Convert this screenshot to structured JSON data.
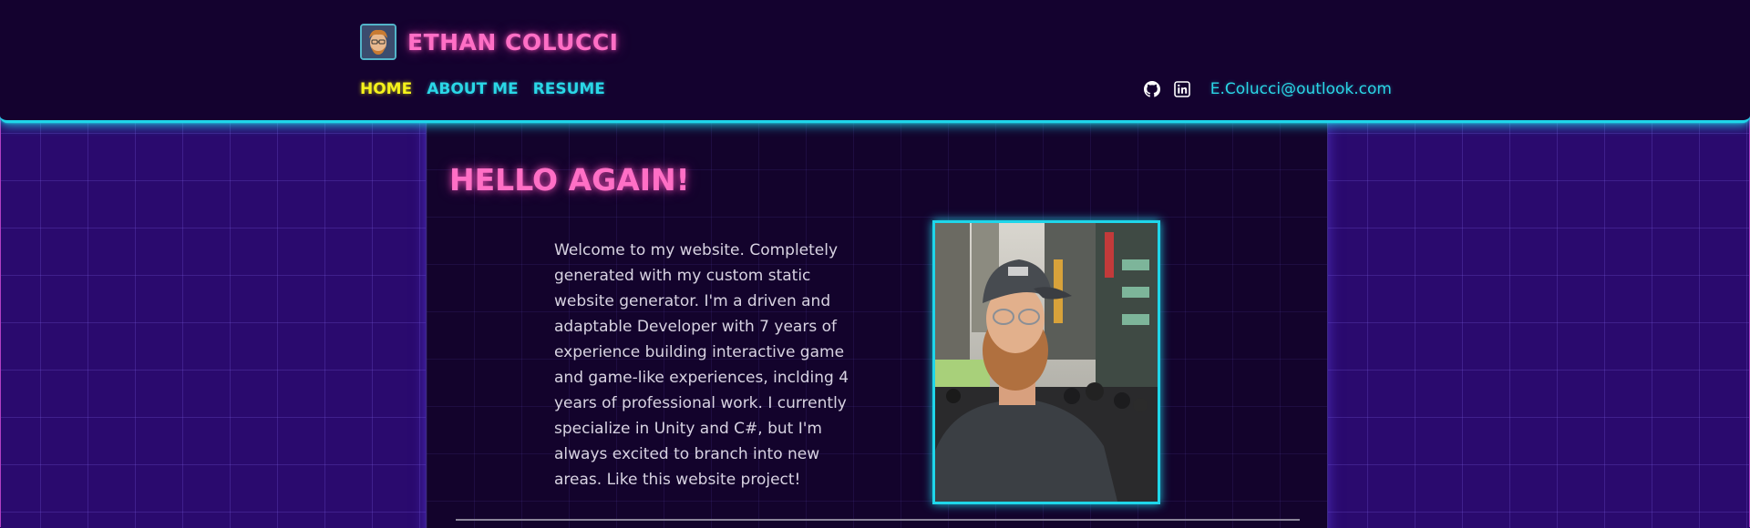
{
  "header": {
    "brand_name": "ETHAN COLUCCI",
    "nav": [
      {
        "label": "HOME",
        "active": true
      },
      {
        "label": "ABOUT ME",
        "active": false
      },
      {
        "label": "RESUME",
        "active": false
      }
    ],
    "social_icons": [
      "github-icon",
      "linkedin-icon"
    ],
    "email": "E.Colucci@outlook.com"
  },
  "main": {
    "title": "HELLO AGAIN!",
    "intro": "Welcome to my website. Completely generated with my custom static website generator. I'm a driven and adaptable Developer with 7 years of experience building interactive game and game-like experiences, inclding 4 years of professional work. I currently specialize in Unity and C#, but I'm always excited to branch into new areas. Like this website project!"
  },
  "colors": {
    "background": "#2a0a6e",
    "panel": "#13032c",
    "accent_cyan": "#1fd6ea",
    "accent_pink": "#ff6fc5",
    "active_yellow": "#f5f21b"
  }
}
